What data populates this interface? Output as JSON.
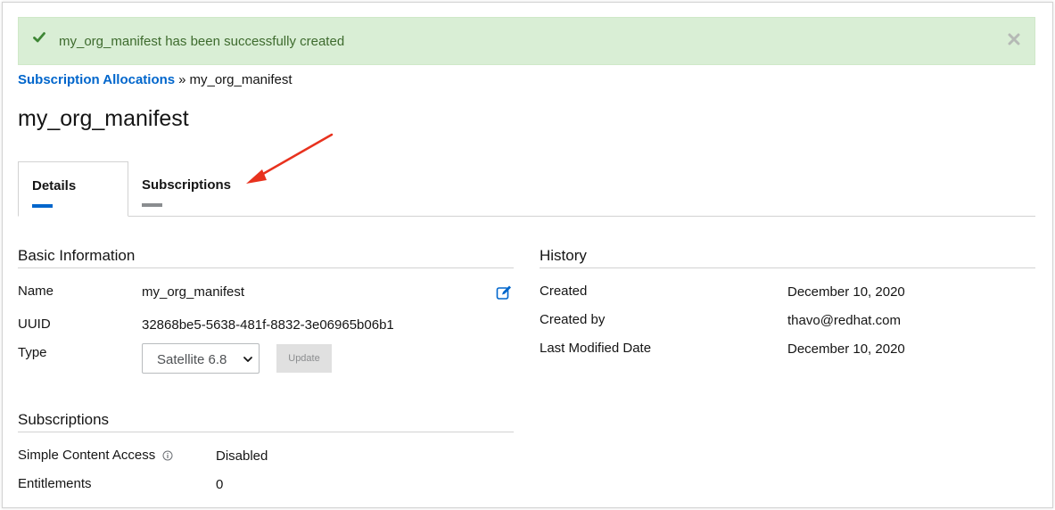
{
  "alert": {
    "message": "my_org_manifest has been successfully created",
    "icon": "check-icon",
    "close_icon": "close-icon",
    "color": "#d9eed5"
  },
  "breadcrumb": {
    "parent": "Subscription Allocations",
    "separator": "»",
    "current": "my_org_manifest"
  },
  "page_title": "my_org_manifest",
  "tabs": [
    {
      "label": "Details",
      "active": true
    },
    {
      "label": "Subscriptions",
      "active": false
    }
  ],
  "basic_info": {
    "title": "Basic Information",
    "name_label": "Name",
    "name_value": "my_org_manifest",
    "uuid_label": "UUID",
    "uuid_value": "32868be5-5638-481f-8832-3e06965b06b1",
    "type_label": "Type",
    "type_selected": "Satellite 6.8",
    "update_label": "Update"
  },
  "history": {
    "title": "History",
    "created_label": "Created",
    "created_value": "December 10, 2020",
    "created_by_label": "Created by",
    "created_by_value": "thavo@redhat.com",
    "modified_label": "Last Modified Date",
    "modified_value": "December 10, 2020"
  },
  "subscriptions": {
    "title": "Subscriptions",
    "sca_label": "Simple Content Access",
    "sca_value": "Disabled",
    "entitlements_label": "Entitlements",
    "entitlements_value": "0"
  },
  "colors": {
    "link": "#0066cc",
    "success_text": "#3e6b2e",
    "annotation_arrow": "#e8321e"
  }
}
